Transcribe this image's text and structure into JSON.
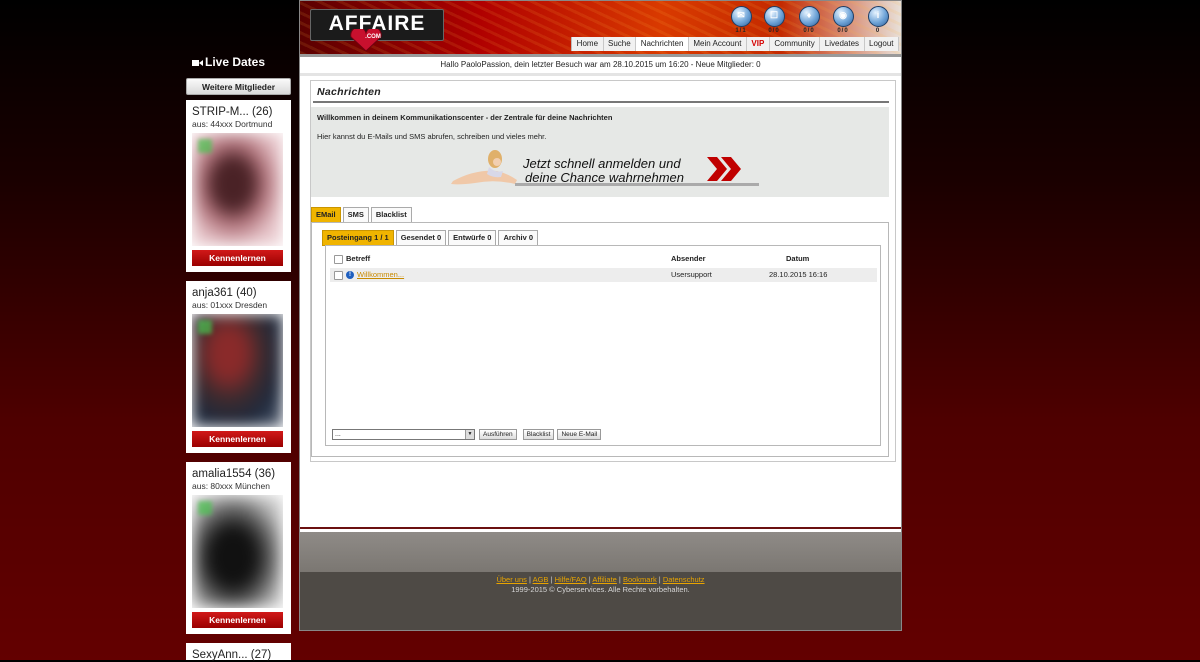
{
  "live_dates": {
    "title": "Live Dates",
    "more_button": "Weitere Mitglieder",
    "members": [
      {
        "name": "STRIP-M... (26)",
        "location": "aus: 44xxx Dortmund",
        "button": "Kennenlernen"
      },
      {
        "name": "anja361 (40)",
        "location": "aus: 01xxx Dresden",
        "button": "Kennenlernen"
      },
      {
        "name": "amalia1554 (36)",
        "location": "aus: 80xxx München",
        "button": "Kennenlernen"
      },
      {
        "name": "SexyAnn... (27)"
      }
    ]
  },
  "header": {
    "logo_text": "AFFAIRE",
    "logo_sub": ".COM",
    "icons": [
      {
        "icon": "mail-icon",
        "count": "1/1"
      },
      {
        "icon": "messages-icon",
        "count": "0/0"
      },
      {
        "icon": "gift-icon",
        "count": "0/0"
      },
      {
        "icon": "visitors-icon",
        "count": "0/0"
      },
      {
        "icon": "info-icon",
        "count": "0"
      }
    ],
    "nav": [
      "Home",
      "Suche",
      "Nachrichten",
      "Mein Account",
      "VIP",
      "Community",
      "Livedates",
      "Logout"
    ],
    "nav_active": "Nachrichten"
  },
  "greeting": "Hallo PaoloPassion, dein letzter Besuch war am 28.10.2015 um 16:20 - Neue Mitglieder: 0",
  "content": {
    "title": "Nachrichten",
    "intro_heading": "Willkommen in deinem Kommunikationscenter - der Zentrale für deine Nachrichten",
    "intro_text": "Hier kannst du E-Mails und SMS abrufen, schreiben und vieles mehr.",
    "banner_line1": "Jetzt schnell anmelden und",
    "banner_line2": "deine Chance wahrnehmen",
    "tabs": [
      "EMail",
      "SMS",
      "Blacklist"
    ],
    "subtabs": [
      "Posteingang 1 / 1",
      "Gesendet 0",
      "Entwürfe 0",
      "Archiv 0"
    ],
    "table": {
      "columns": {
        "subject": "Betreff",
        "sender": "Absender",
        "date": "Datum"
      },
      "rows": [
        {
          "subject": "Willkommen...",
          "sender": "Usersupport",
          "date": "28.10.2015 16:16"
        }
      ]
    },
    "action_select_value": "...",
    "buttons": {
      "execute": "Ausführen",
      "blacklist": "Blacklist",
      "new_email": "Neue E-Mail"
    }
  },
  "footer": {
    "links": [
      "Über uns",
      "AGB",
      "Hilfe/FAQ",
      "Affiliate",
      "Bookmark",
      "Datenschutz"
    ],
    "copyright": "1999-2015 © Cyberservices. Alle Rechte vorbehalten."
  },
  "colors": {
    "accent_tab": "#f0b400",
    "button_red": "#b80000",
    "link": "#c88a00"
  }
}
